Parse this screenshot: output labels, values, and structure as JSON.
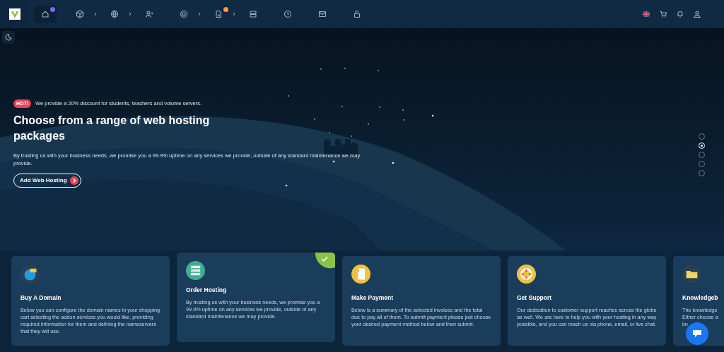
{
  "nav": {
    "items": [
      {
        "selected": true,
        "submenu": false,
        "color": "#7c6cf0"
      },
      {
        "selected": false,
        "submenu": true
      },
      {
        "selected": false,
        "submenu": true
      },
      {
        "selected": false,
        "submenu": false
      },
      {
        "selected": false,
        "submenu": true
      },
      {
        "selected": false,
        "submenu": true,
        "color": "#f6a13b"
      },
      {
        "selected": false,
        "submenu": false
      },
      {
        "selected": false,
        "submenu": false
      },
      {
        "selected": false,
        "submenu": false
      },
      {
        "selected": false,
        "submenu": false
      }
    ]
  },
  "hero": {
    "badge": "HOT!",
    "announcement": "We provide a 20% discount for students, teachers and volume servers.",
    "title": "Choose from a range of web hosting packages",
    "description": "By trusting us with your business needs, we promise you a 99.9% uptime on any services we provide, outside of any standard maintenance we may provide.",
    "button": "Add Web Hosting",
    "slides": [
      {
        "selected": false
      },
      {
        "selected": true
      },
      {
        "selected": false
      },
      {
        "selected": false
      },
      {
        "selected": false
      }
    ]
  },
  "cards": [
    {
      "title": "Buy A Domain",
      "selected": false,
      "lines": [
        "Below you can configure the domain names in your shopping cart selecting the addon services you would like, providing required information for them and defining the nameservers that they will use."
      ]
    },
    {
      "title": "Order Hosting",
      "selected": true,
      "lines": [
        "By trusting us with your business needs, we promise you a 99.9% uptime on any services we provide, outside of any standard maintenance we may provide."
      ]
    },
    {
      "title": "Make Payment",
      "selected": false,
      "lines": [
        "Below is a summary of the selected invoices and the total due to pay all of them. To submit payment please just choose your desired payment method below and then submit."
      ]
    },
    {
      "title": "Get Support",
      "selected": false,
      "lines": [
        "Our dedication to customer support reaches across the globe as well. We are here to help you with your hosting in any way possible, and you can reach us via phone, email, or live chat."
      ]
    },
    {
      "title": "Knowledgeb",
      "selected": false,
      "lines": [
        "The knowledge",
        "Either choose a",
        "kn"
      ]
    }
  ]
}
